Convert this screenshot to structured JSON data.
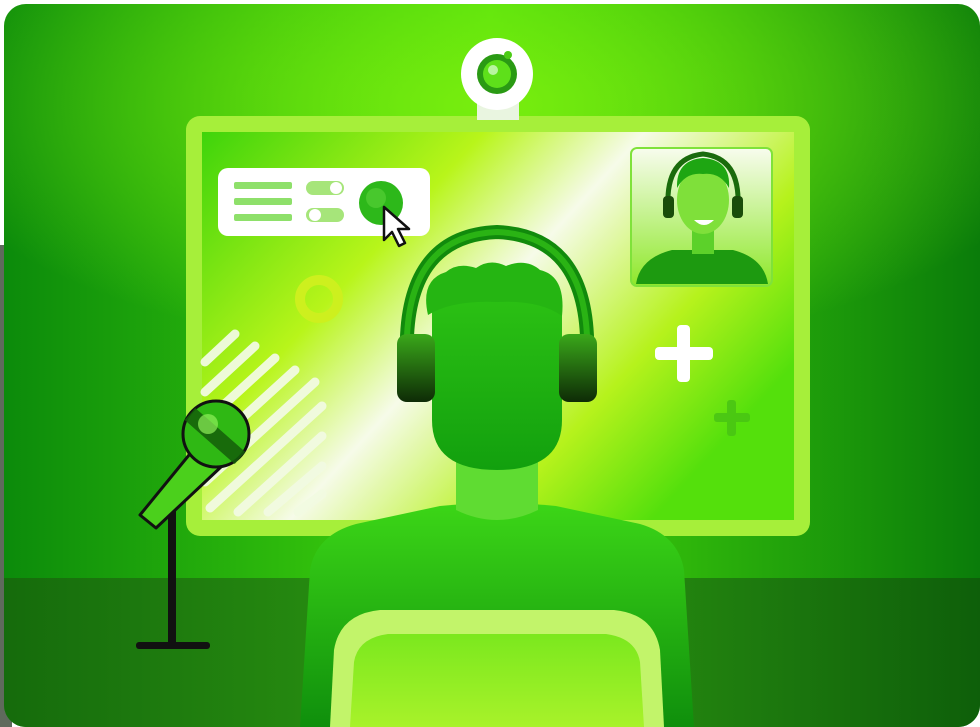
{
  "colors": {
    "background_dark": "#0a7a0a",
    "background_light": "#3fd60a",
    "screen_light": "#f4fbe8",
    "screen_green": "#7ff00e",
    "accent_lime": "#c8f51e",
    "floor": "#1f7f10",
    "person_green": "#2fc814",
    "white": "#ffffff",
    "black": "#111111"
  },
  "icons": [
    "webcam-icon",
    "toggle-icon",
    "cursor-icon",
    "microphone-icon",
    "headphones-icon",
    "plus-icon",
    "ring-icon"
  ],
  "settings_card": {
    "toggles_on": [
      true,
      true
    ]
  }
}
